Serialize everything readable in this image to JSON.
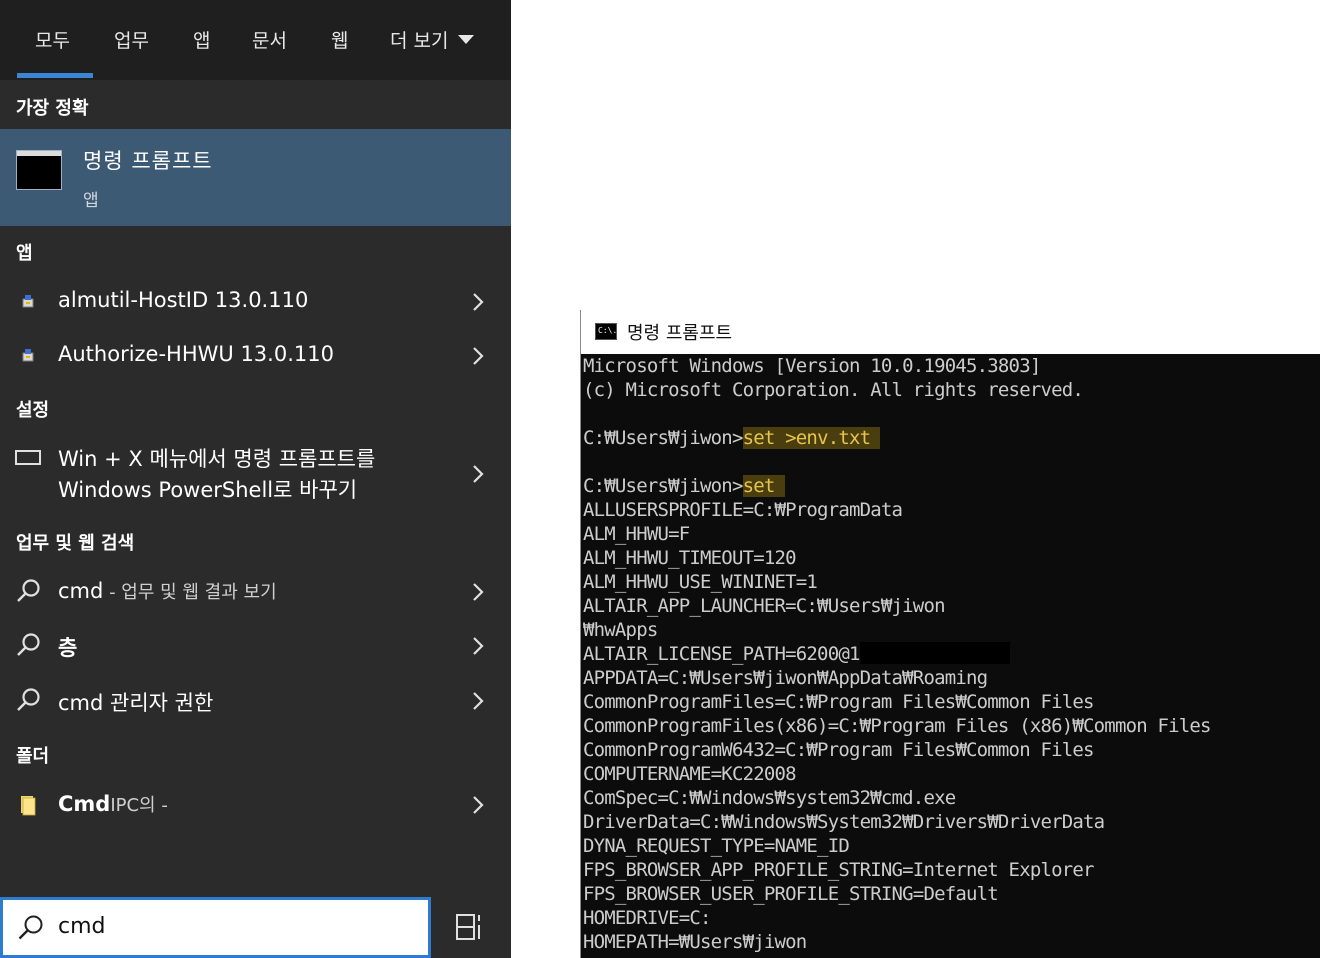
{
  "search_panel": {
    "tabs": [
      {
        "label": "모두"
      },
      {
        "label": "업무"
      },
      {
        "label": "앱"
      },
      {
        "label": "문서"
      },
      {
        "label": "웹"
      },
      {
        "label": "더 보기"
      }
    ],
    "sections": {
      "best_match": "가장 정확",
      "apps": "앱",
      "settings": "설정",
      "web_search": "업무 및 웹 검색",
      "folders": "폴더"
    },
    "best_match": {
      "title": "명령 프롬프트",
      "subtitle": "앱"
    },
    "apps": [
      {
        "label": "almutil-HostID 13.0.110"
      },
      {
        "label": "Authorize-HHWU 13.0.110"
      }
    ],
    "settings_item": {
      "line1": "Win + X 메뉴에서 명령 프롬프트를",
      "line2": "Windows PowerShell로 바꾸기"
    },
    "web_results": [
      {
        "bold": "cmd",
        "muted": " - 업무 및 웹 결과 보기"
      },
      {
        "bold": "층",
        "muted": ""
      },
      {
        "bold": "cmd 관리자 권한",
        "muted": ""
      }
    ],
    "folder_item": {
      "bold": "Cmd",
      "muted": "IPC의 -"
    },
    "search_box": {
      "value": "cmd"
    }
  },
  "cmd_window": {
    "title": "명령 프롬프트",
    "icon_text": "C:\\.",
    "lines": [
      {
        "text": "Microsoft Windows [Version 10.0.19045.3803]"
      },
      {
        "text": "(c) Microsoft Corporation. All rights reserved."
      },
      {
        "text": ""
      },
      {
        "prompt": "C:₩Users₩jiwon>",
        "cmd": "set >env.txt"
      },
      {
        "text": ""
      },
      {
        "prompt": "C:₩Users₩jiwon>",
        "cmd": "set"
      },
      {
        "text": "ALLUSERSPROFILE=C:₩ProgramData"
      },
      {
        "text": "ALM_HHWU=F"
      },
      {
        "text": "ALM_HHWU_TIMEOUT=120"
      },
      {
        "text": "ALM_HHWU_USE_WININET=1"
      },
      {
        "text": "ALTAIR_APP_LAUNCHER=C:₩Users₩jiwon"
      },
      {
        "text": "₩hwApps"
      },
      {
        "text": "ALTAIR_LICENSE_PATH=6200@1",
        "redacted": true
      },
      {
        "text": "APPDATA=C:₩Users₩jiwon₩AppData₩Roaming"
      },
      {
        "text": "CommonProgramFiles=C:₩Program Files₩Common Files"
      },
      {
        "text": "CommonProgramFiles(x86)=C:₩Program Files (x86)₩Common Files"
      },
      {
        "text": "CommonProgramW6432=C:₩Program Files₩Common Files"
      },
      {
        "text": "COMPUTERNAME=KC22008"
      },
      {
        "text": "ComSpec=C:₩Windows₩system32₩cmd.exe"
      },
      {
        "text": "DriverData=C:₩Windows₩System32₩Drivers₩DriverData"
      },
      {
        "text": "DYNA_REQUEST_TYPE=NAME_ID"
      },
      {
        "text": "FPS_BROWSER_APP_PROFILE_STRING=Internet Explorer"
      },
      {
        "text": "FPS_BROWSER_USER_PROFILE_STRING=Default"
      },
      {
        "text": "HOMEDRIVE=C:"
      },
      {
        "text": "HOMEPATH=₩Users₩jiwon"
      }
    ]
  },
  "colors": {
    "panel_bg": "#2b2b2b",
    "tabs_bg": "#1f1f1f",
    "accent": "#3a86d3",
    "selected_bg": "#3d5a74",
    "cmd_bg": "#0c0c0c",
    "cmd_text": "#cccccc",
    "highlight_bg": "#4a3d0e",
    "highlight_text": "#e8c54a"
  }
}
